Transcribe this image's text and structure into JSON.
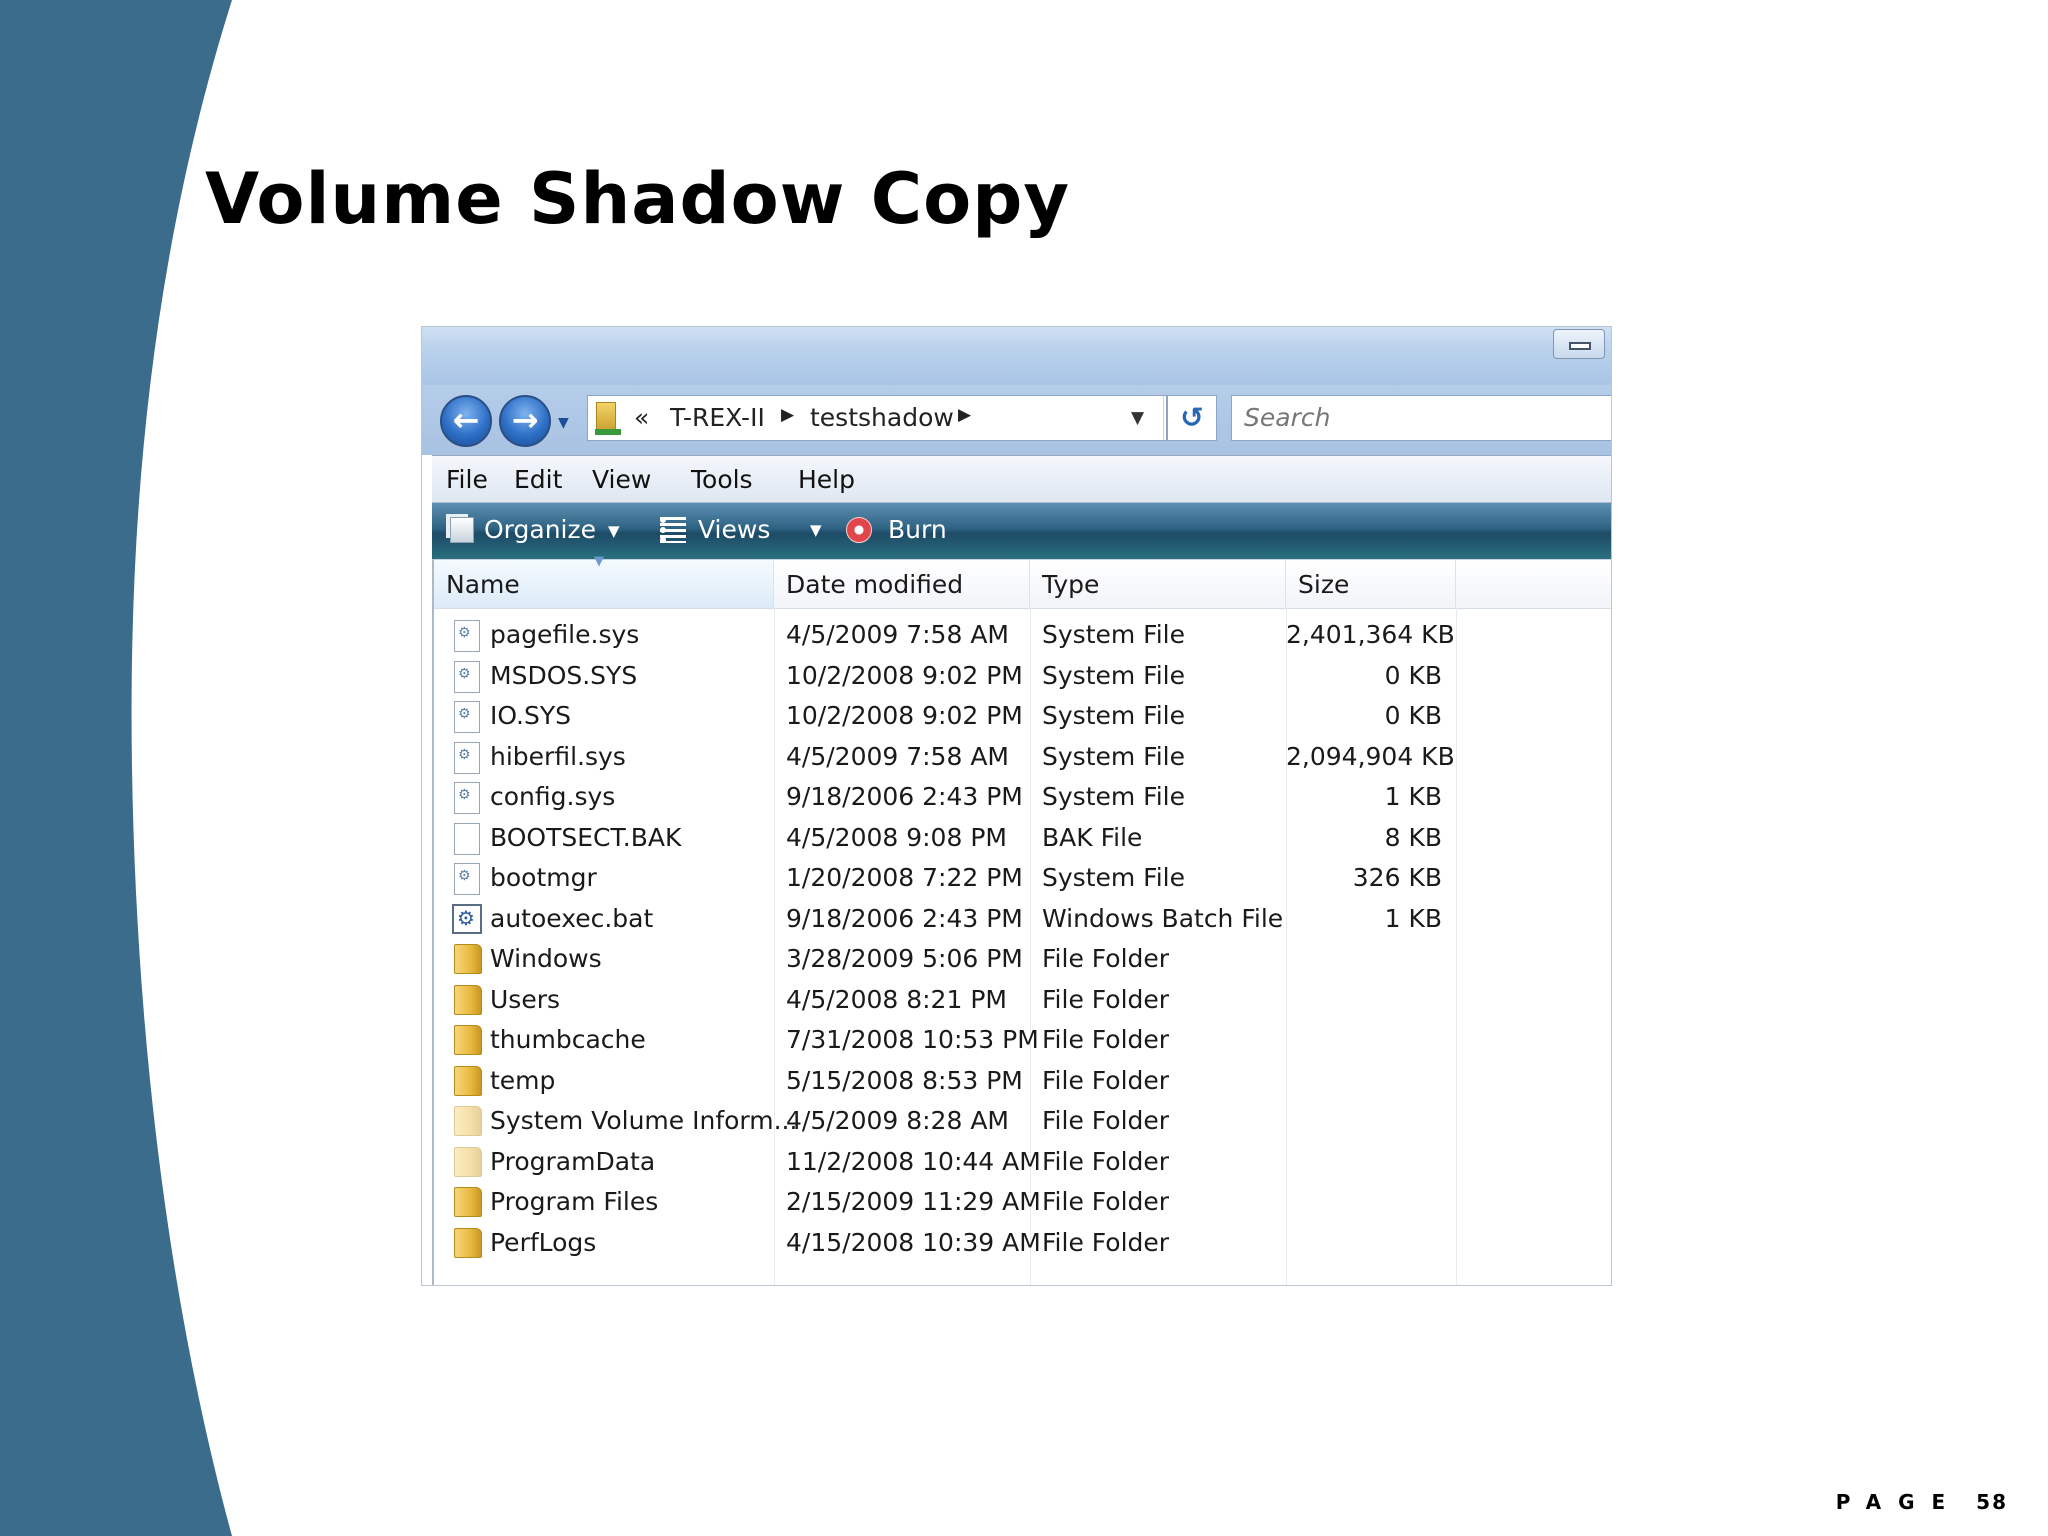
{
  "slide": {
    "title": "Volume Shadow Copy",
    "page_label": "PAGE",
    "page_number": "58",
    "band_color": "#3b6c8c"
  },
  "explorer": {
    "nav": {
      "back_icon": "back-arrow-icon",
      "forward_icon": "forward-arrow-icon",
      "back_glyph": "←",
      "forward_glyph": "→",
      "history_caret": "▼"
    },
    "address": {
      "chevrons": "«",
      "segments": [
        "T-REX-II",
        "testshadow"
      ],
      "separator": "▶",
      "dropdown": "▼"
    },
    "refresh_glyph": "↺",
    "search_placeholder": "Search",
    "menu": [
      "File",
      "Edit",
      "View",
      "Tools",
      "Help"
    ],
    "toolbar": {
      "organize": "Organize",
      "views": "Views",
      "burn": "Burn",
      "caret": "▼"
    },
    "columns": {
      "name": "Name",
      "date": "Date modified",
      "type": "Type",
      "size": "Size"
    },
    "files": [
      {
        "name": "pagefile.sys",
        "date": "4/5/2009 7:58 AM",
        "type": "System File",
        "size": "2,401,364 KB",
        "icon": "sys"
      },
      {
        "name": "MSDOS.SYS",
        "date": "10/2/2008 9:02 PM",
        "type": "System File",
        "size": "0 KB",
        "icon": "sys"
      },
      {
        "name": "IO.SYS",
        "date": "10/2/2008 9:02 PM",
        "type": "System File",
        "size": "0 KB",
        "icon": "sys"
      },
      {
        "name": "hiberfil.sys",
        "date": "4/5/2009 7:58 AM",
        "type": "System File",
        "size": "2,094,904 KB",
        "icon": "sys"
      },
      {
        "name": "config.sys",
        "date": "9/18/2006 2:43 PM",
        "type": "System File",
        "size": "1 KB",
        "icon": "sys"
      },
      {
        "name": "BOOTSECT.BAK",
        "date": "4/5/2008 9:08 PM",
        "type": "BAK File",
        "size": "8 KB",
        "icon": "blank"
      },
      {
        "name": "bootmgr",
        "date": "1/20/2008 7:22 PM",
        "type": "System File",
        "size": "326 KB",
        "icon": "sys"
      },
      {
        "name": "autoexec.bat",
        "date": "9/18/2006 2:43 PM",
        "type": "Windows Batch File",
        "size": "1 KB",
        "icon": "batch"
      },
      {
        "name": "Windows",
        "date": "3/28/2009 5:06 PM",
        "type": "File Folder",
        "size": "",
        "icon": "folder"
      },
      {
        "name": "Users",
        "date": "4/5/2008 8:21 PM",
        "type": "File Folder",
        "size": "",
        "icon": "folder"
      },
      {
        "name": "thumbcache",
        "date": "7/31/2008 10:53 PM",
        "type": "File Folder",
        "size": "",
        "icon": "folder"
      },
      {
        "name": "temp",
        "date": "5/15/2008 8:53 PM",
        "type": "File Folder",
        "size": "",
        "icon": "folder"
      },
      {
        "name": "System Volume Inform...",
        "date": "4/5/2009 8:28 AM",
        "type": "File Folder",
        "size": "",
        "icon": "folder faded"
      },
      {
        "name": "ProgramData",
        "date": "11/2/2008 10:44 AM",
        "type": "File Folder",
        "size": "",
        "icon": "folder faded"
      },
      {
        "name": "Program Files",
        "date": "2/15/2009 11:29 AM",
        "type": "File Folder",
        "size": "",
        "icon": "folder"
      },
      {
        "name": "PerfLogs",
        "date": "4/15/2008 10:39 AM",
        "type": "File Folder",
        "size": "",
        "icon": "folder"
      }
    ]
  }
}
